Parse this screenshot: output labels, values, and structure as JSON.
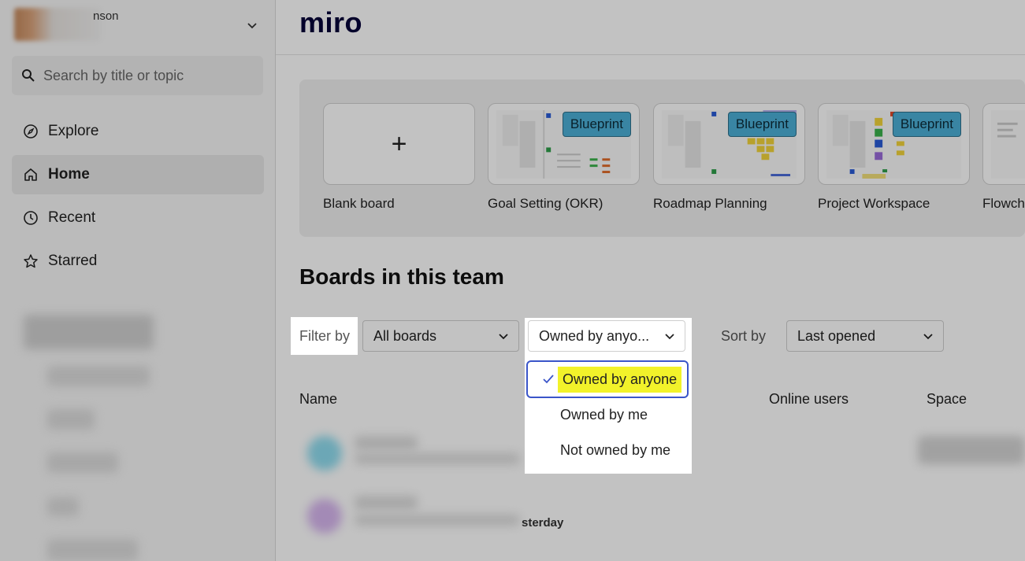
{
  "sidebar": {
    "user_name": "nson",
    "search_placeholder": "Search by title or topic",
    "nav": [
      {
        "label": "Explore",
        "icon": "compass-icon"
      },
      {
        "label": "Home",
        "icon": "home-icon"
      },
      {
        "label": "Recent",
        "icon": "clock-icon"
      },
      {
        "label": "Starred",
        "icon": "star-icon"
      }
    ]
  },
  "header": {
    "logo": "miro"
  },
  "templates": [
    {
      "label": "Blank board",
      "badge": ""
    },
    {
      "label": "Goal Setting (OKR)",
      "badge": "Blueprint"
    },
    {
      "label": "Roadmap Planning",
      "badge": "Blueprint"
    },
    {
      "label": "Project Workspace",
      "badge": "Blueprint"
    },
    {
      "label": "Flowch",
      "badge": ""
    }
  ],
  "boards": {
    "title": "Boards in this team",
    "filter_label": "Filter by",
    "filter_boards": "All boards",
    "filter_owner": "Owned by anyo...",
    "sort_label": "Sort by",
    "sort_value": "Last opened",
    "columns": [
      "Name",
      "Online users",
      "Space"
    ],
    "row2_partial_text": "sterday"
  },
  "owner_dropdown": {
    "options": [
      "Owned by anyone",
      "Owned by me",
      "Not owned by me"
    ],
    "selected_index": 0
  },
  "colors": {
    "accent_blue": "#3a55c9",
    "highlight_yellow": "#f2f22a",
    "badge_bg": "#4bafd6"
  }
}
